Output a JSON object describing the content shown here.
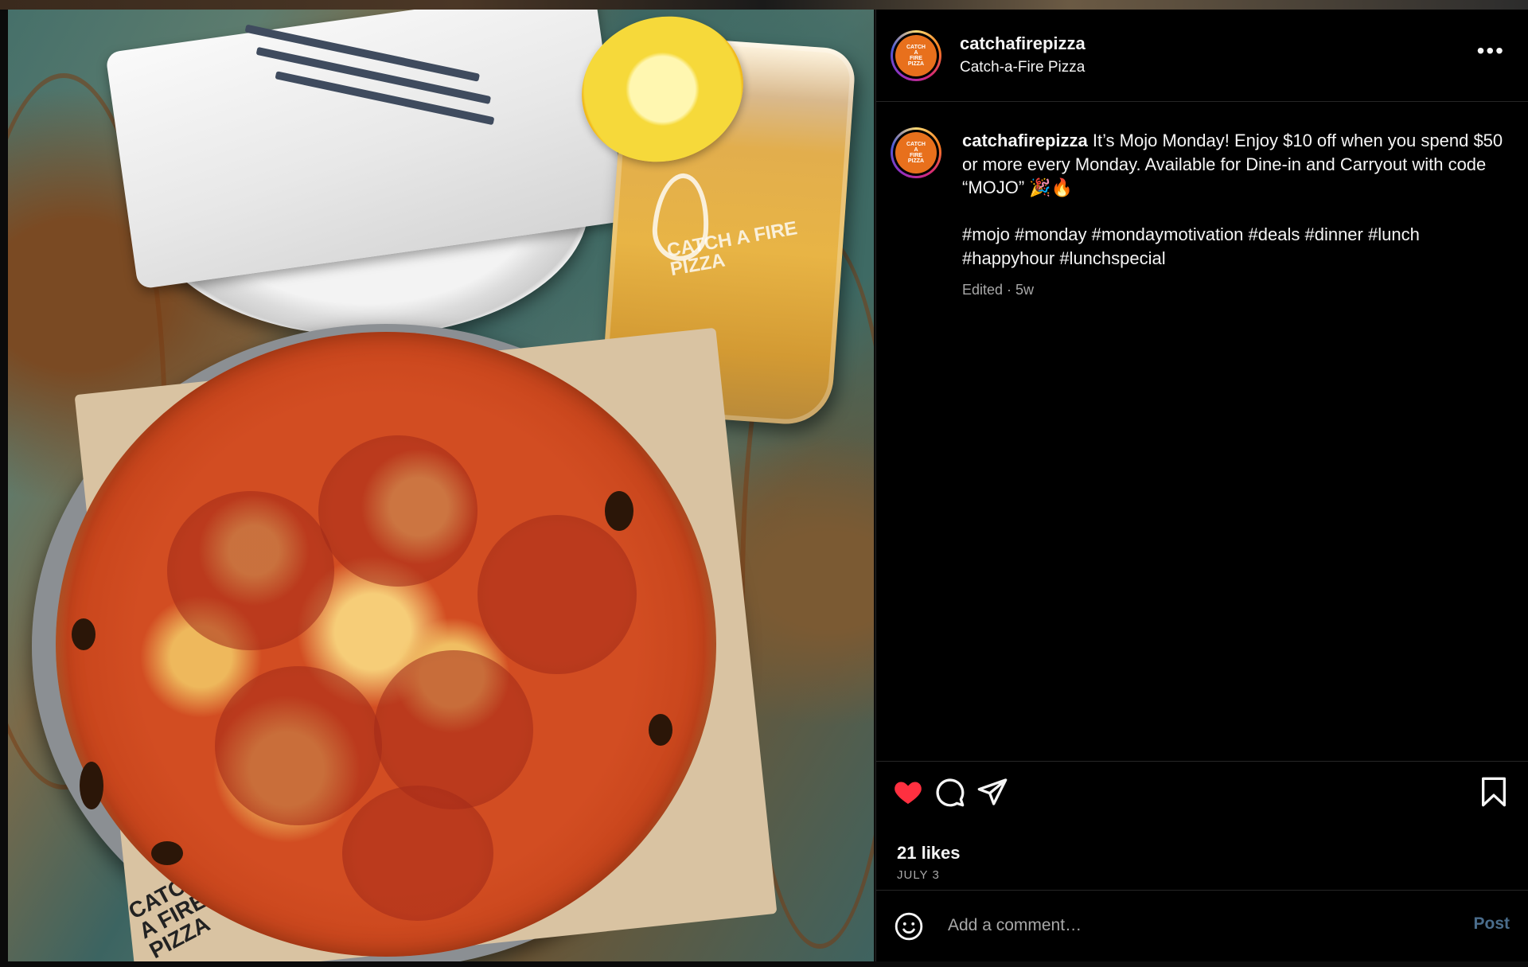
{
  "post": {
    "image_alt": "Pepperoni pizza on a metal tray beside a beer with a lemon wedge and stacked plates",
    "glass_logo": "CATCH A FIRE PIZZA",
    "paper_logo": "CATCH A FIRE PIZZA"
  },
  "header": {
    "username": "catchafirepizza",
    "subtitle": "Catch-a-Fire Pizza",
    "avatar_text": [
      "CATCH",
      "A",
      "FIRE",
      "PIZZA"
    ],
    "more_icon": "more-horizontal-icon"
  },
  "caption": {
    "username": "catchafirepizza",
    "text": " It’s Mojo Monday! Enjoy $10 off when you spend $50 or more every Monday. Available for Dine-in and Carryout with code “MOJO” 🎉🔥",
    "hashtags": "#mojo #monday #mondaymotivation #deals #dinner #lunch #happyhour #lunchspecial",
    "meta": "Edited · 5w"
  },
  "actions": {
    "like_icon": "heart-filled-icon",
    "comment_icon": "comment-icon",
    "share_icon": "share-icon",
    "save_icon": "bookmark-icon",
    "likes": "21 likes",
    "date": "JULY 3"
  },
  "comment": {
    "placeholder": "Add a comment…",
    "post_label": "Post",
    "emoji_icon": "emoji-icon"
  },
  "colors": {
    "like": "#ff3040",
    "post_button": "#4a6d8c",
    "avatar_bg": "#e8701c"
  }
}
